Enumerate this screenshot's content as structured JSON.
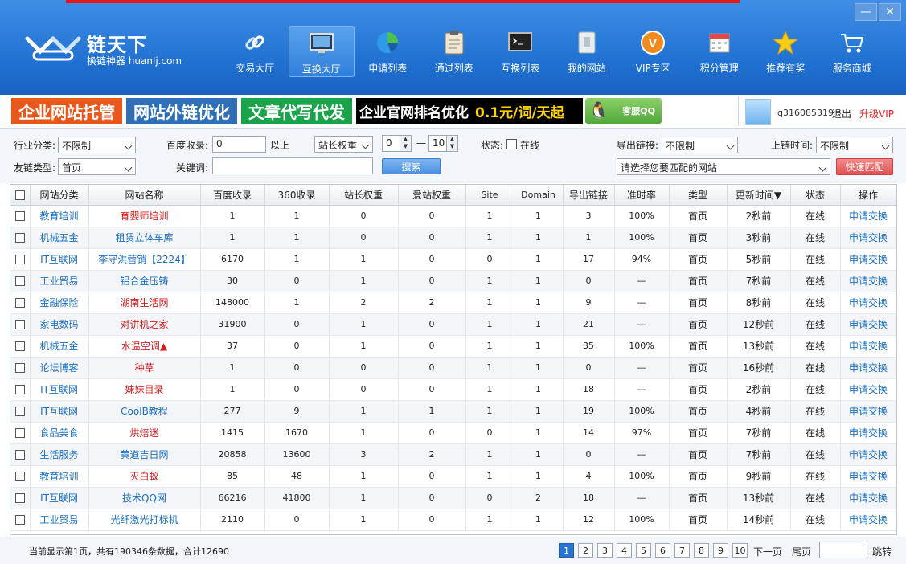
{
  "app": {
    "logo_name": "链天下",
    "logo_sub": "换链神器 huanlj.com",
    "win_min": "—",
    "win_close": "✕"
  },
  "colors": {
    "accent": "#1e6fd0",
    "brand_red": "#e22",
    "link": "#1a6fc4"
  },
  "nav": [
    {
      "label": "交易大厅",
      "icon": "link-icon"
    },
    {
      "label": "互换大厅",
      "icon": "monitor-icon",
      "active": true
    },
    {
      "label": "申请列表",
      "icon": "pie-chart-icon"
    },
    {
      "label": "通过列表",
      "icon": "clipboard-icon"
    },
    {
      "label": "互换列表",
      "icon": "terminal-icon"
    },
    {
      "label": "我的网站",
      "icon": "page-icon"
    },
    {
      "label": "VIP专区",
      "icon": "vip-icon"
    },
    {
      "label": "积分管理",
      "icon": "calendar-icon"
    },
    {
      "label": "推荐有奖",
      "icon": "star-icon"
    },
    {
      "label": "服务商城",
      "icon": "cart-icon"
    }
  ],
  "ads": {
    "a1": "企业网站托管",
    "a2": "网站外链优化",
    "a3": "文章代写代发",
    "a4_text": "企业官网排名优化",
    "a4_price": "0.1元/词/天起",
    "qq": "客服QQ"
  },
  "user": {
    "name": "q316085319",
    "logout": "退出",
    "vip": "升级VIP"
  },
  "filters": {
    "industry_label": "行业分类:",
    "industry_value": "不限制",
    "linktype_label": "友链类型:",
    "linktype_value": "首页",
    "baidu_label": "百度收录:",
    "baidu_value": "0",
    "baidu_suffix": "以上",
    "weight_select": "站长权重",
    "weight_min": "0",
    "weight_dash": "—",
    "weight_max": "10",
    "status_label": "状态:",
    "status_option": "在线",
    "keyword_label": "关键词:",
    "keyword_value": "",
    "search_button": "搜索",
    "outlinks_label": "导出链接:",
    "outlinks_value": "不限制",
    "online_time_label": "上链时间:",
    "online_time_value": "不限制",
    "match_site_placeholder": "请选择您要匹配的网站",
    "quick_match_button": "快速匹配"
  },
  "table": {
    "headers": [
      "网站分类",
      "网站名称",
      "百度收录",
      "360收录",
      "站长权重",
      "爱站权重",
      "Site",
      "Domain",
      "导出链接",
      "准时率",
      "类型",
      "更新时间▼",
      "状态",
      "操作"
    ],
    "rows": [
      {
        "cat": "教育培训",
        "name": "育婴师培训",
        "name_color": "#d31b1b",
        "baidu": "1",
        "s360": "1",
        "zz": "0",
        "az": "0",
        "site": "1",
        "domain": "1",
        "out": "3",
        "rate": "100%",
        "type": "首页",
        "time": "2秒前",
        "status": "在线",
        "action": "申请交换"
      },
      {
        "cat": "机械五金",
        "name": "租赁立体车库",
        "name_color": "#1a6fc4",
        "baidu": "1",
        "s360": "1",
        "zz": "0",
        "az": "0",
        "site": "1",
        "domain": "1",
        "out": "1",
        "rate": "100%",
        "type": "首页",
        "time": "3秒前",
        "status": "在线",
        "action": "申请交换"
      },
      {
        "cat": "IT互联网",
        "name": "李守洪营销【2224】",
        "name_color": "#1a6fc4",
        "baidu": "6170",
        "s360": "1",
        "zz": "1",
        "az": "0",
        "site": "0",
        "domain": "1",
        "out": "17",
        "rate": "94%",
        "type": "首页",
        "time": "5秒前",
        "status": "在线",
        "action": "申请交换"
      },
      {
        "cat": "工业贸易",
        "name": "铝合金压铸",
        "name_color": "#1a6fc4",
        "baidu": "30",
        "s360": "0",
        "zz": "1",
        "az": "0",
        "site": "1",
        "domain": "1",
        "out": "0",
        "rate": "—",
        "type": "首页",
        "time": "7秒前",
        "status": "在线",
        "action": "申请交换"
      },
      {
        "cat": "金融保险",
        "name": "湖南生活网",
        "name_color": "#d31b1b",
        "baidu": "148000",
        "s360": "1",
        "zz": "2",
        "az": "2",
        "site": "1",
        "domain": "1",
        "out": "9",
        "rate": "—",
        "type": "首页",
        "time": "8秒前",
        "status": "在线",
        "action": "申请交换"
      },
      {
        "cat": "家电数码",
        "name": "对讲机之家",
        "name_color": "#d31b1b",
        "baidu": "31900",
        "s360": "0",
        "zz": "1",
        "az": "0",
        "site": "1",
        "domain": "1",
        "out": "21",
        "rate": "—",
        "type": "首页",
        "time": "12秒前",
        "status": "在线",
        "action": "申请交换"
      },
      {
        "cat": "机械五金",
        "name": "水温空调▲",
        "name_color": "#d31b1b",
        "baidu": "37",
        "s360": "0",
        "zz": "1",
        "az": "0",
        "site": "1",
        "domain": "1",
        "out": "35",
        "rate": "100%",
        "type": "首页",
        "time": "13秒前",
        "status": "在线",
        "action": "申请交换"
      },
      {
        "cat": "论坛博客",
        "name": "种草",
        "name_color": "#d31b1b",
        "baidu": "1",
        "s360": "0",
        "zz": "0",
        "az": "0",
        "site": "1",
        "domain": "1",
        "out": "0",
        "rate": "—",
        "type": "首页",
        "time": "16秒前",
        "status": "在线",
        "action": "申请交换"
      },
      {
        "cat": "IT互联网",
        "name": "妹妹目录",
        "name_color": "#d31b1b",
        "baidu": "1",
        "s360": "0",
        "zz": "0",
        "az": "0",
        "site": "1",
        "domain": "1",
        "out": "18",
        "rate": "—",
        "type": "首页",
        "time": "2秒前",
        "status": "在线",
        "action": "申请交换"
      },
      {
        "cat": "IT互联网",
        "name": "CoolB教程",
        "name_color": "#1a6fc4",
        "baidu": "277",
        "s360": "9",
        "zz": "1",
        "az": "1",
        "site": "1",
        "domain": "1",
        "out": "19",
        "rate": "100%",
        "type": "首页",
        "time": "4秒前",
        "status": "在线",
        "action": "申请交换"
      },
      {
        "cat": "食品美食",
        "name": "烘焙迷",
        "name_color": "#d31b1b",
        "baidu": "1415",
        "s360": "1670",
        "zz": "1",
        "az": "0",
        "site": "0",
        "domain": "1",
        "out": "14",
        "rate": "97%",
        "type": "首页",
        "time": "7秒前",
        "status": "在线",
        "action": "申请交换"
      },
      {
        "cat": "生活服务",
        "name": "黄道吉日网",
        "name_color": "#1a6fc4",
        "baidu": "20858",
        "s360": "13600",
        "zz": "3",
        "az": "2",
        "site": "1",
        "domain": "1",
        "out": "0",
        "rate": "—",
        "type": "首页",
        "time": "7秒前",
        "status": "在线",
        "action": "申请交换"
      },
      {
        "cat": "教育培训",
        "name": "灭白蚁",
        "name_color": "#d31b1b",
        "baidu": "85",
        "s360": "48",
        "zz": "1",
        "az": "0",
        "site": "1",
        "domain": "1",
        "out": "4",
        "rate": "100%",
        "type": "首页",
        "time": "9秒前",
        "status": "在线",
        "action": "申请交换"
      },
      {
        "cat": "IT互联网",
        "name": "技术QQ网",
        "name_color": "#1a6fc4",
        "baidu": "66216",
        "s360": "41800",
        "zz": "1",
        "az": "0",
        "site": "0",
        "domain": "2",
        "out": "18",
        "rate": "—",
        "type": "首页",
        "time": "13秒前",
        "status": "在线",
        "action": "申请交换"
      },
      {
        "cat": "工业贸易",
        "name": "光纤激光打标机",
        "name_color": "#1a6fc4",
        "baidu": "2110",
        "s360": "0",
        "zz": "1",
        "az": "0",
        "site": "1",
        "domain": "1",
        "out": "12",
        "rate": "100%",
        "type": "首页",
        "time": "14秒前",
        "status": "在线",
        "action": "申请交换"
      }
    ]
  },
  "pager": {
    "info": "当前显示第1页，共有190346条数据，合计12690",
    "pages": [
      "1",
      "2",
      "3",
      "4",
      "5",
      "6",
      "7",
      "8",
      "9",
      "10"
    ],
    "current": "1",
    "next": "下一页",
    "last": "尾页",
    "jump_value": "",
    "jump": "跳转"
  }
}
